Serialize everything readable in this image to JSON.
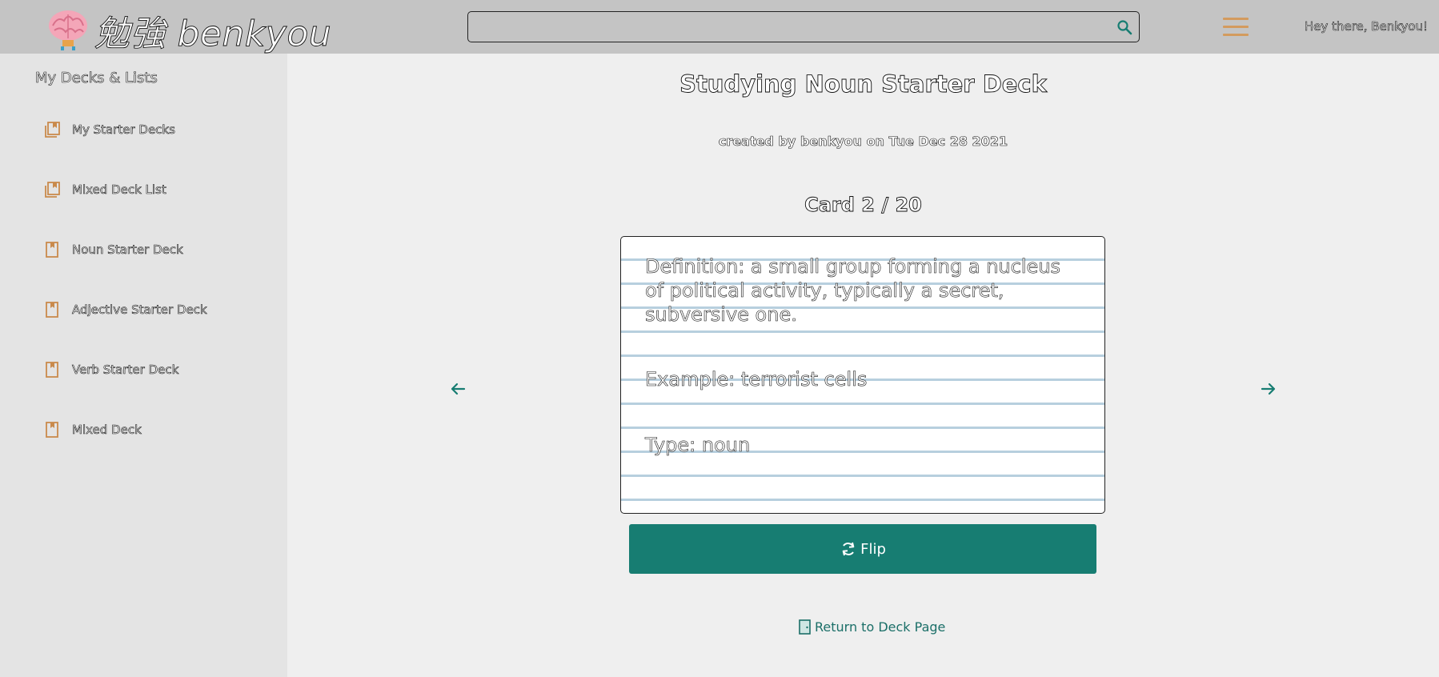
{
  "header": {
    "logo_text": "勉強 benkyou",
    "search": {
      "value": "",
      "placeholder": ""
    },
    "greeting": "Hey there, Benkyou!"
  },
  "sidebar": {
    "title": "My Decks & Lists",
    "items": [
      {
        "label": "My Starter Decks",
        "icon": "deck-list-icon"
      },
      {
        "label": "Mixed Deck List",
        "icon": "deck-list-icon"
      },
      {
        "label": "Noun Starter Deck",
        "icon": "deck-icon"
      },
      {
        "label": "Adjective Starter Deck",
        "icon": "deck-icon"
      },
      {
        "label": "Verb Starter Deck",
        "icon": "deck-icon"
      },
      {
        "label": "Mixed Deck",
        "icon": "deck-icon"
      }
    ]
  },
  "main": {
    "title": "Studying Noun Starter Deck",
    "subtitle": "created by benkyou on Tue Dec 28 2021",
    "counter": "Card 2 / 20",
    "card": {
      "definition": "Definition: a small group forming a nucleus of political activity, typically a secret, subversive one.",
      "example": "Example: terrorist cells",
      "type": "Type: noun"
    },
    "flip_label": "Flip",
    "return_label": "Return to Deck Page"
  },
  "colors": {
    "header_bg": "#c4c4c4",
    "sidebar_bg": "#e4e4e4",
    "page_bg": "#efefef",
    "accent_teal": "#177d72",
    "accent_orange": "#d39b5e",
    "card_line": "#b7cfde"
  }
}
